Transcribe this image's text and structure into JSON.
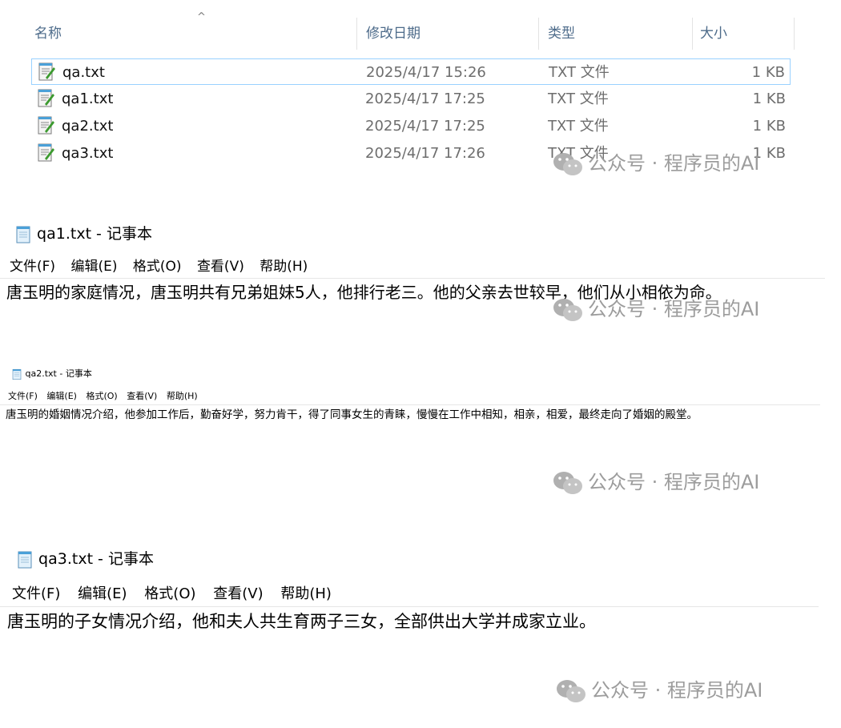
{
  "explorer": {
    "columns": {
      "name": "名称",
      "modified": "修改日期",
      "type": "类型",
      "size": "大小"
    },
    "sort_indicator": "^",
    "files": [
      {
        "name": "qa.txt",
        "modified": "2025/4/17 15:26",
        "type": "TXT 文件",
        "size": "1 KB",
        "selected": true
      },
      {
        "name": "qa1.txt",
        "modified": "2025/4/17 17:25",
        "type": "TXT 文件",
        "size": "1 KB",
        "selected": false
      },
      {
        "name": "qa2.txt",
        "modified": "2025/4/17 17:25",
        "type": "TXT 文件",
        "size": "1 KB",
        "selected": false
      },
      {
        "name": "qa3.txt",
        "modified": "2025/4/17 17:26",
        "type": "TXT 文件",
        "size": "1 KB",
        "selected": false
      }
    ]
  },
  "notepad_qa1": {
    "title": "qa1.txt - 记事本",
    "menu": {
      "file": "文件(F)",
      "edit": "编辑(E)",
      "format": "格式(O)",
      "view": "查看(V)",
      "help": "帮助(H)"
    },
    "content": "唐玉明的家庭情况，唐玉明共有兄弟姐妹5人，他排行老三。他的父亲去世较早，他们从小相依为命。"
  },
  "notepad_qa2": {
    "title": "qa2.txt - 记事本",
    "menu": {
      "file": "文件(F)",
      "edit": "编辑(E)",
      "format": "格式(O)",
      "view": "查看(V)",
      "help": "帮助(H)"
    },
    "content": "唐玉明的婚姻情况介绍，他参加工作后，勤奋好学，努力肯干，得了同事女生的青睐，慢慢在工作中相知，相亲，相爱，最终走向了婚姻的殿堂。"
  },
  "notepad_qa3": {
    "title": "qa3.txt - 记事本",
    "menu": {
      "file": "文件(F)",
      "edit": "编辑(E)",
      "format": "格式(O)",
      "view": "查看(V)",
      "help": "帮助(H)"
    },
    "content": "唐玉明的子女情况介绍，他和夫人共生育两子三女，全部供出大学并成家立业。"
  },
  "watermark": {
    "text": "公众号 · 程序员的AI",
    "icon": "wechat-icon"
  },
  "colors": {
    "selection_border": "#99d1ff",
    "header_text": "#4d6b8a",
    "watermark": "#9c9c9c"
  }
}
